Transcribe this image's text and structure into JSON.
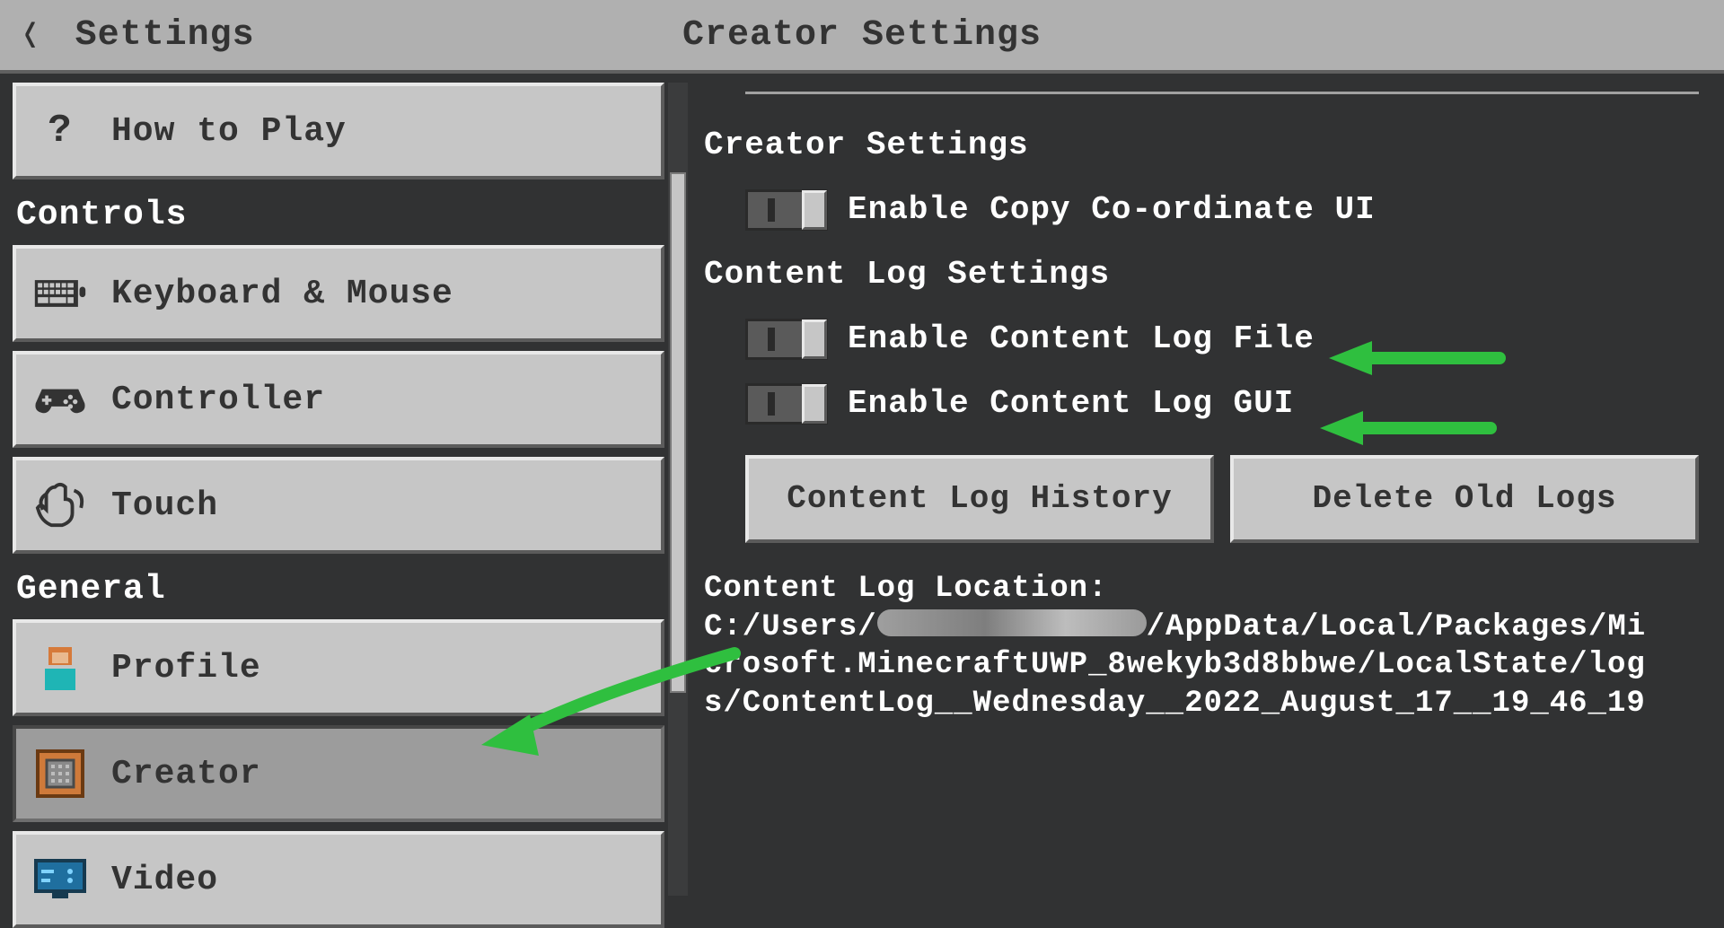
{
  "topbar": {
    "back_label": "Settings",
    "title": "Creator Settings"
  },
  "sidebar": {
    "items": [
      {
        "label": "How to Play",
        "icon": "question-icon"
      },
      {
        "label": "Keyboard & Mouse",
        "icon": "keyboard-icon"
      },
      {
        "label": "Controller",
        "icon": "gamepad-icon"
      },
      {
        "label": "Touch",
        "icon": "touch-icon"
      },
      {
        "label": "Profile",
        "icon": "profile-icon"
      },
      {
        "label": "Creator",
        "icon": "commandblock-icon"
      },
      {
        "label": "Video",
        "icon": "monitor-icon"
      }
    ],
    "sections": {
      "controls": "Controls",
      "general": "General"
    }
  },
  "panel": {
    "group1_title": "Creator Settings",
    "toggle1_label": "Enable Copy Co-ordinate UI",
    "group2_title": "Content Log Settings",
    "toggle2_label": "Enable Content Log File",
    "toggle3_label": "Enable Content Log GUI",
    "btn_history": "Content Log History",
    "btn_delete": "Delete Old Logs",
    "loc_title": "Content Log Location:",
    "loc_path_prefix": "C:/Users/",
    "loc_path_suffix": "/AppData/Local/Packages/Microsoft.MinecraftUWP_8wekyb3d8bbwe/LocalState/logs/ContentLog__Wednesday__2022_August_17__19_46_19"
  }
}
